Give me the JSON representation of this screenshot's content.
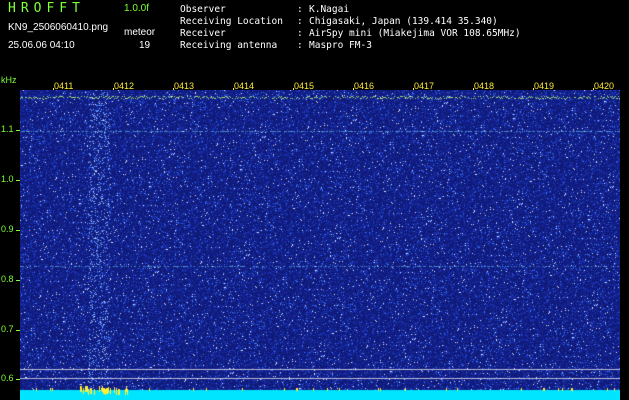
{
  "header": {
    "app_title": "HROFFT",
    "version": "1.0.0f",
    "filename": "KN9_2506060410.png",
    "datetime": "25.06.06 04:10",
    "meteor_label": "meteor",
    "meteor_count": "19"
  },
  "station_info": [
    {
      "label": "Observer",
      "value": "K.Nagai"
    },
    {
      "label": "Receiving Location",
      "value": "Chigasaki, Japan (139.414 35.340)"
    },
    {
      "label": "Receiver",
      "value": "AirSpy mini (Miakejima VOR 108.65MHz)"
    },
    {
      "label": "Receiving antenna",
      "value": "Maspro FM-3"
    }
  ],
  "colon": ":",
  "axes": {
    "y_unit": "kHz",
    "y_ticks": [
      "1.1",
      "1.0",
      "0.9",
      "0.8",
      "0.7",
      "0.6"
    ],
    "x_ticks": [
      "0411",
      "0412",
      "0413",
      "0414",
      "0415",
      "0416",
      "0417",
      "0418",
      "0419",
      "0420"
    ]
  },
  "colors": {
    "label_green": "#7dff3a",
    "time_yellow": "#ffee33",
    "background_blue": "#101a78",
    "baseline_cyan": "#00e5ff"
  }
}
